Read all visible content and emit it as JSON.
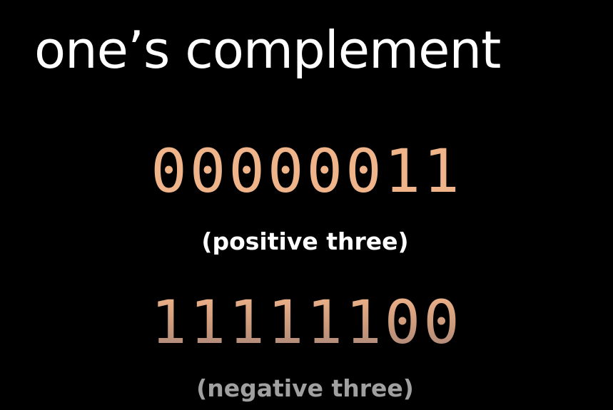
{
  "slide": {
    "title": "one’s complement",
    "positive": {
      "binary": "00000011",
      "caption": "(positive three)"
    },
    "negative": {
      "binary": "11111100",
      "caption": "(negative three)"
    }
  },
  "colors": {
    "background": "#000000",
    "title": "#ffffff",
    "binary_digits": "#f0b48a",
    "positive_caption": "#ffffff",
    "negative_caption": "#a0a0a0"
  }
}
